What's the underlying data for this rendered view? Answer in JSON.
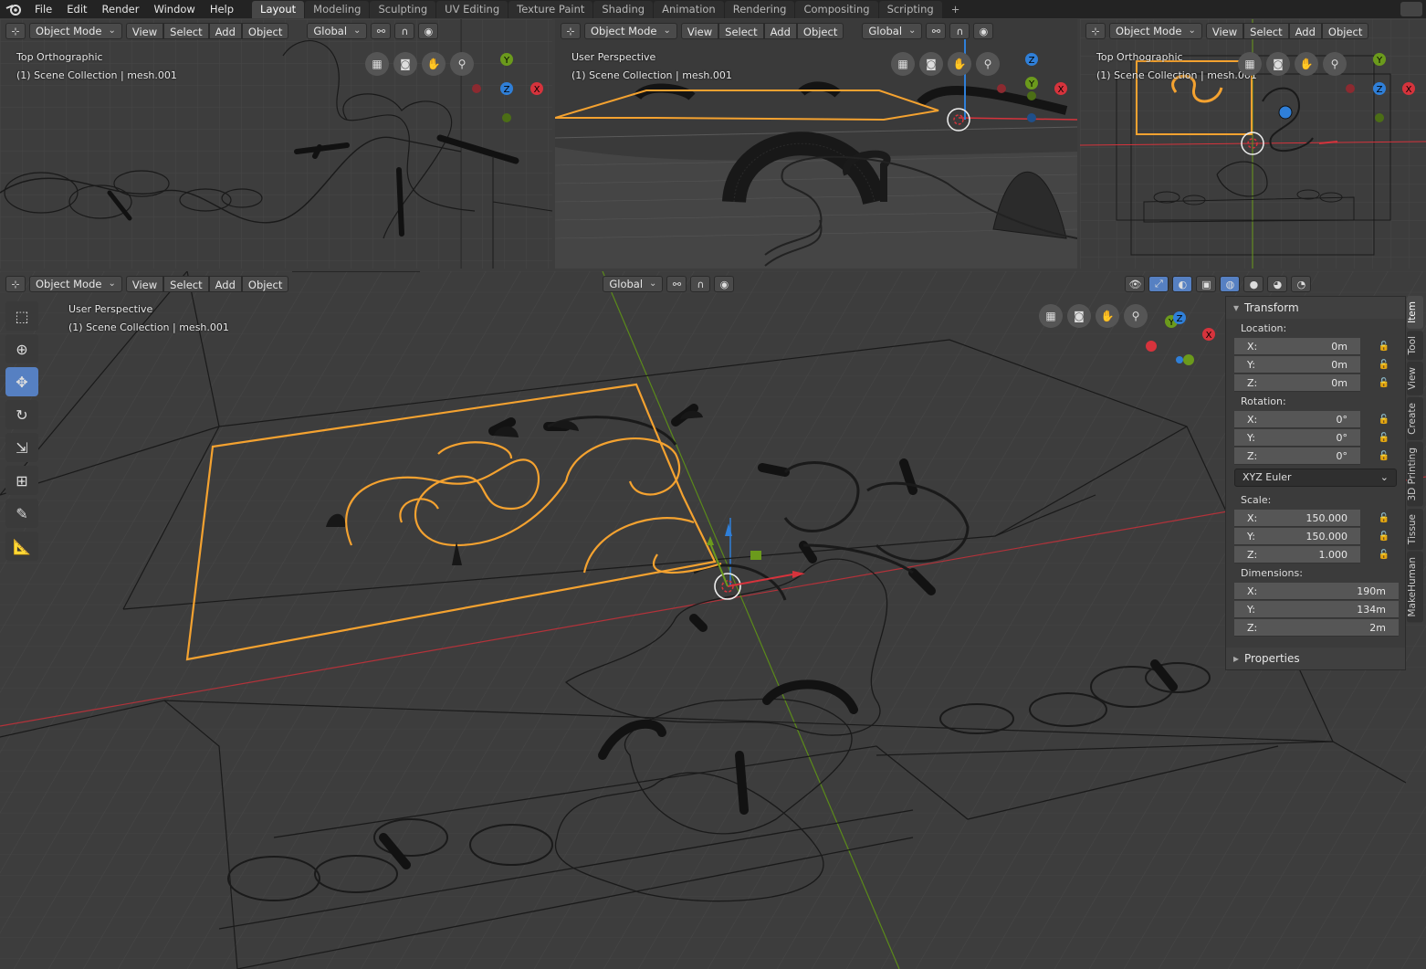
{
  "menu": [
    "File",
    "Edit",
    "Render",
    "Window",
    "Help"
  ],
  "workspaces": [
    "Layout",
    "Modeling",
    "Sculpting",
    "UV Editing",
    "Texture Paint",
    "Shading",
    "Animation",
    "Rendering",
    "Compositing",
    "Scripting"
  ],
  "workspace_add": "+",
  "header": {
    "mode": "Object Mode",
    "view": "View",
    "select": "Select",
    "add": "Add",
    "object": "Object",
    "orientation": "Global"
  },
  "viewports": {
    "top_left": {
      "title": "Top Orthographic",
      "collection": "(1) Scene Collection | mesh.001"
    },
    "top_mid": {
      "title": "User Perspective",
      "collection": "(1) Scene Collection | mesh.001"
    },
    "top_right": {
      "title": "Top Orthographic",
      "collection": "(1) Scene Collection | mesh.001"
    },
    "main": {
      "title": "User Perspective",
      "collection": "(1) Scene Collection | mesh.001"
    }
  },
  "axes": {
    "x": "X",
    "y": "Y",
    "z": "Z"
  },
  "transform": {
    "title": "Transform",
    "location_label": "Location:",
    "location": [
      {
        "axis": "X:",
        "value": "0m"
      },
      {
        "axis": "Y:",
        "value": "0m"
      },
      {
        "axis": "Z:",
        "value": "0m"
      }
    ],
    "rotation_label": "Rotation:",
    "rotation": [
      {
        "axis": "X:",
        "value": "0°"
      },
      {
        "axis": "Y:",
        "value": "0°"
      },
      {
        "axis": "Z:",
        "value": "0°"
      }
    ],
    "rotation_mode": "XYZ Euler",
    "scale_label": "Scale:",
    "scale": [
      {
        "axis": "X:",
        "value": "150.000"
      },
      {
        "axis": "Y:",
        "value": "150.000"
      },
      {
        "axis": "Z:",
        "value": "1.000"
      }
    ],
    "dimensions_label": "Dimensions:",
    "dimensions": [
      {
        "axis": "X:",
        "value": "190m"
      },
      {
        "axis": "Y:",
        "value": "134m"
      },
      {
        "axis": "Z:",
        "value": "2m"
      }
    ],
    "properties": "Properties"
  },
  "sidebar_tabs": [
    "Item",
    "Tool",
    "View",
    "Create",
    "3D Printing",
    "Tissue",
    "MakeHuman"
  ],
  "colors": {
    "accent": "#5680c2",
    "selected": "#f4a230",
    "x_axis": "#d6333c",
    "y_axis": "#6b9a1c",
    "z_axis": "#2f7fd8",
    "grid": "#474747"
  }
}
